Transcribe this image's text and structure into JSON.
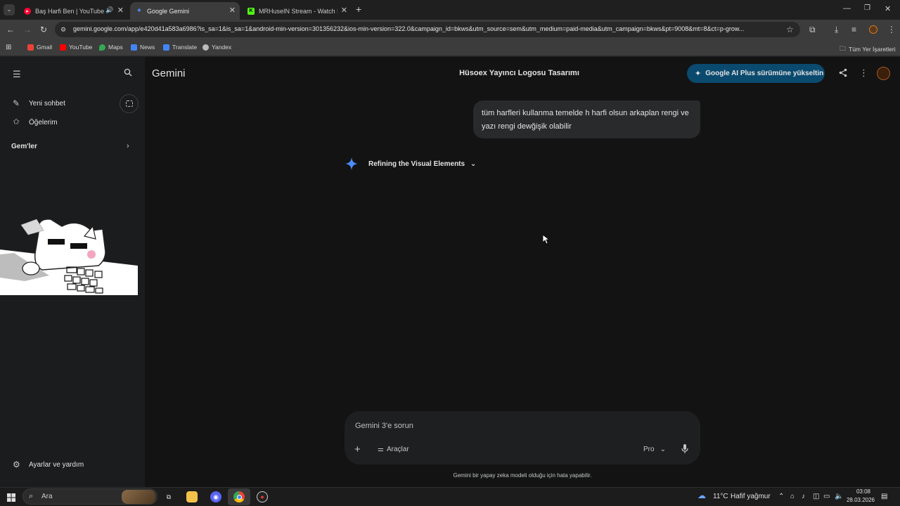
{
  "browser": {
    "tabs": [
      {
        "title": "Baş Harfi Ben | YouTube Mu",
        "favicon": "youtube-music-icon",
        "color": "#ff0033",
        "active": false
      },
      {
        "title": "Google Gemini",
        "favicon": "gemini-icon",
        "color": "#4c8df6",
        "active": true
      },
      {
        "title": "MRHuseIN Stream - Watch Live",
        "favicon": "kick-icon",
        "color": "#53fc18",
        "active": false
      }
    ],
    "url": "gemini.google.com/app/e420d41a583a6986?is_sa=1&is_sa=1&android-min-version=301356232&ios-min-version=322.0&campaign_id=bkws&utm_source=sem&utm_medium=paid-media&utm_campaign=bkws&pt=9008&mt=8&ct=p-grow...",
    "bookmarks": [
      {
        "label": "Gmail",
        "icon": "gmail-icon",
        "color": "#ea4335"
      },
      {
        "label": "YouTube",
        "icon": "youtube-icon",
        "color": "#ff0000"
      },
      {
        "label": "Maps",
        "icon": "maps-icon",
        "color": "#34a853"
      },
      {
        "label": "News",
        "icon": "news-icon",
        "color": "#4285f4"
      },
      {
        "label": "Translate",
        "icon": "translate-icon",
        "color": "#4285f4"
      },
      {
        "label": "Yandex",
        "icon": "yandex-icon",
        "color": "#cccccc"
      }
    ],
    "all_bookmarks": "Tüm Yer İşaretleri"
  },
  "sidebar": {
    "new_chat": "Yeni sohbet",
    "my_items": "Öğelerim",
    "gems": "Gem'ler",
    "settings": "Ayarlar ve yardım"
  },
  "header": {
    "brand": "Gemini",
    "chat_title": "Hüsoex Yayıncı Logosu Tasarımı",
    "upgrade_label": "Google AI Plus sürümüne yükseltin"
  },
  "conversation": {
    "user_message": "tüm harfleri kullanma temelde h harfi olsun arkaplan rengi ve yazı rengi dewğişik olabilir",
    "thinking_label": "Refining the Visual Elements"
  },
  "composer": {
    "placeholder": "Gemini 3'e sorun",
    "tools_label": "Araçlar",
    "model_label": "Pro",
    "disclaimer": "Gemini bir yapay zeka modeli olduğu için hata yapabilir."
  },
  "taskbar": {
    "search_label": "Ara",
    "weather_temp": "11°C",
    "weather_desc": "Hafif yağmur",
    "time": "03:08",
    "date": "28.03.2026"
  },
  "colors": {
    "accent_blue": "#0b4a6f",
    "gemini_star": "#4c8df6",
    "background": "#131314"
  }
}
